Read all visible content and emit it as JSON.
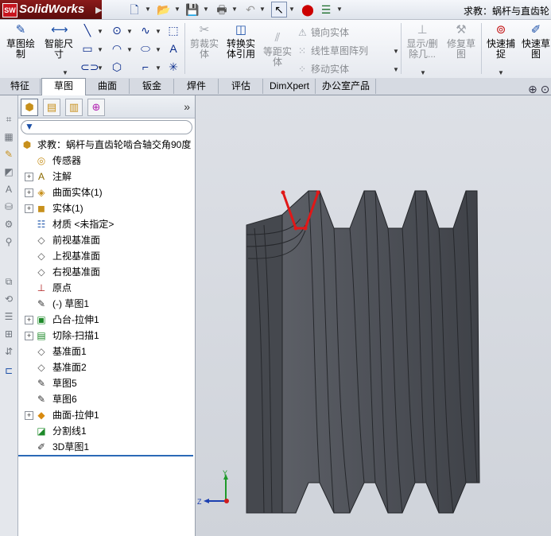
{
  "app": {
    "name": "SolidWorks",
    "logo_mark": "SW"
  },
  "titlebar": {
    "document_title": "求教：蜗杆与直齿轮",
    "icons": [
      "new-icon",
      "open-icon",
      "save-icon",
      "print-icon",
      "undo-icon",
      "select-icon",
      "rebuild-icon",
      "options-icon"
    ]
  },
  "command_manager": {
    "sketch": {
      "label_line1": "草图绘",
      "label_line2": "制"
    },
    "smart_dim": {
      "label_line1": "智能尺",
      "label_line2": "寸"
    },
    "trim": {
      "label_line1": "剪裁实",
      "label_line2": "体"
    },
    "convert": {
      "label_line1": "转换实",
      "label_line2": "体引用"
    },
    "offset": {
      "label_line1": "等距实",
      "label_line2": "体"
    },
    "mirror": "镜向实体",
    "linear_pattern": "线性草图阵列",
    "move": "移动实体",
    "show_delete": {
      "label_line1": "显示/删",
      "label_line2": "除几..."
    },
    "repair": {
      "label_line1": "修复草",
      "label_line2": "图"
    },
    "quick_snap": {
      "label_line1": "快速捕",
      "label_line2": "捉"
    },
    "rapid_sketch": {
      "label_line1": "快速草",
      "label_line2": "图"
    }
  },
  "tabs": [
    "特征",
    "草图",
    "曲面",
    "钣金",
    "焊件",
    "评估",
    "DimXpert",
    "办公室产品"
  ],
  "active_tab": "草图",
  "feature_tree": {
    "root": "求教：蜗杆与直齿轮啮合轴交角90度",
    "items": [
      {
        "label": "传感器",
        "icon": "sensor-icon",
        "expandable": false
      },
      {
        "label": "注解",
        "icon": "annotation-icon",
        "expandable": true
      },
      {
        "label": "曲面实体(1)",
        "icon": "surface-body-icon",
        "expandable": true
      },
      {
        "label": "实体(1)",
        "icon": "solid-body-icon",
        "expandable": true
      },
      {
        "label": "材质 <未指定>",
        "icon": "material-icon",
        "expandable": false
      },
      {
        "label": "前视基准面",
        "icon": "plane-icon",
        "expandable": false
      },
      {
        "label": "上视基准面",
        "icon": "plane-icon",
        "expandable": false
      },
      {
        "label": "右视基准面",
        "icon": "plane-icon",
        "expandable": false
      },
      {
        "label": "原点",
        "icon": "origin-icon",
        "expandable": false
      },
      {
        "label": "(-) 草图1",
        "icon": "sketch-icon",
        "expandable": false
      },
      {
        "label": "凸台-拉伸1",
        "icon": "extrude-icon",
        "expandable": true
      },
      {
        "label": "切除-扫描1",
        "icon": "cut-sweep-icon",
        "expandable": true
      },
      {
        "label": "基准面1",
        "icon": "plane-icon",
        "expandable": false
      },
      {
        "label": "基准面2",
        "icon": "plane-icon",
        "expandable": false
      },
      {
        "label": "草图5",
        "icon": "sketch-icon",
        "expandable": false
      },
      {
        "label": "草图6",
        "icon": "sketch-icon",
        "expandable": false
      },
      {
        "label": "曲面-拉伸1",
        "icon": "surface-extrude-icon",
        "expandable": true
      },
      {
        "label": "分割线1",
        "icon": "split-line-icon",
        "expandable": false
      },
      {
        "label": "3D草图1",
        "icon": "3d-sketch-icon",
        "expandable": false
      }
    ]
  },
  "triad": {
    "y": "Y",
    "z": "Z"
  },
  "colors": {
    "part_body": "#4a4d53",
    "sketch_highlight": "#e01818",
    "tree_end_line": "#2b69b6"
  }
}
